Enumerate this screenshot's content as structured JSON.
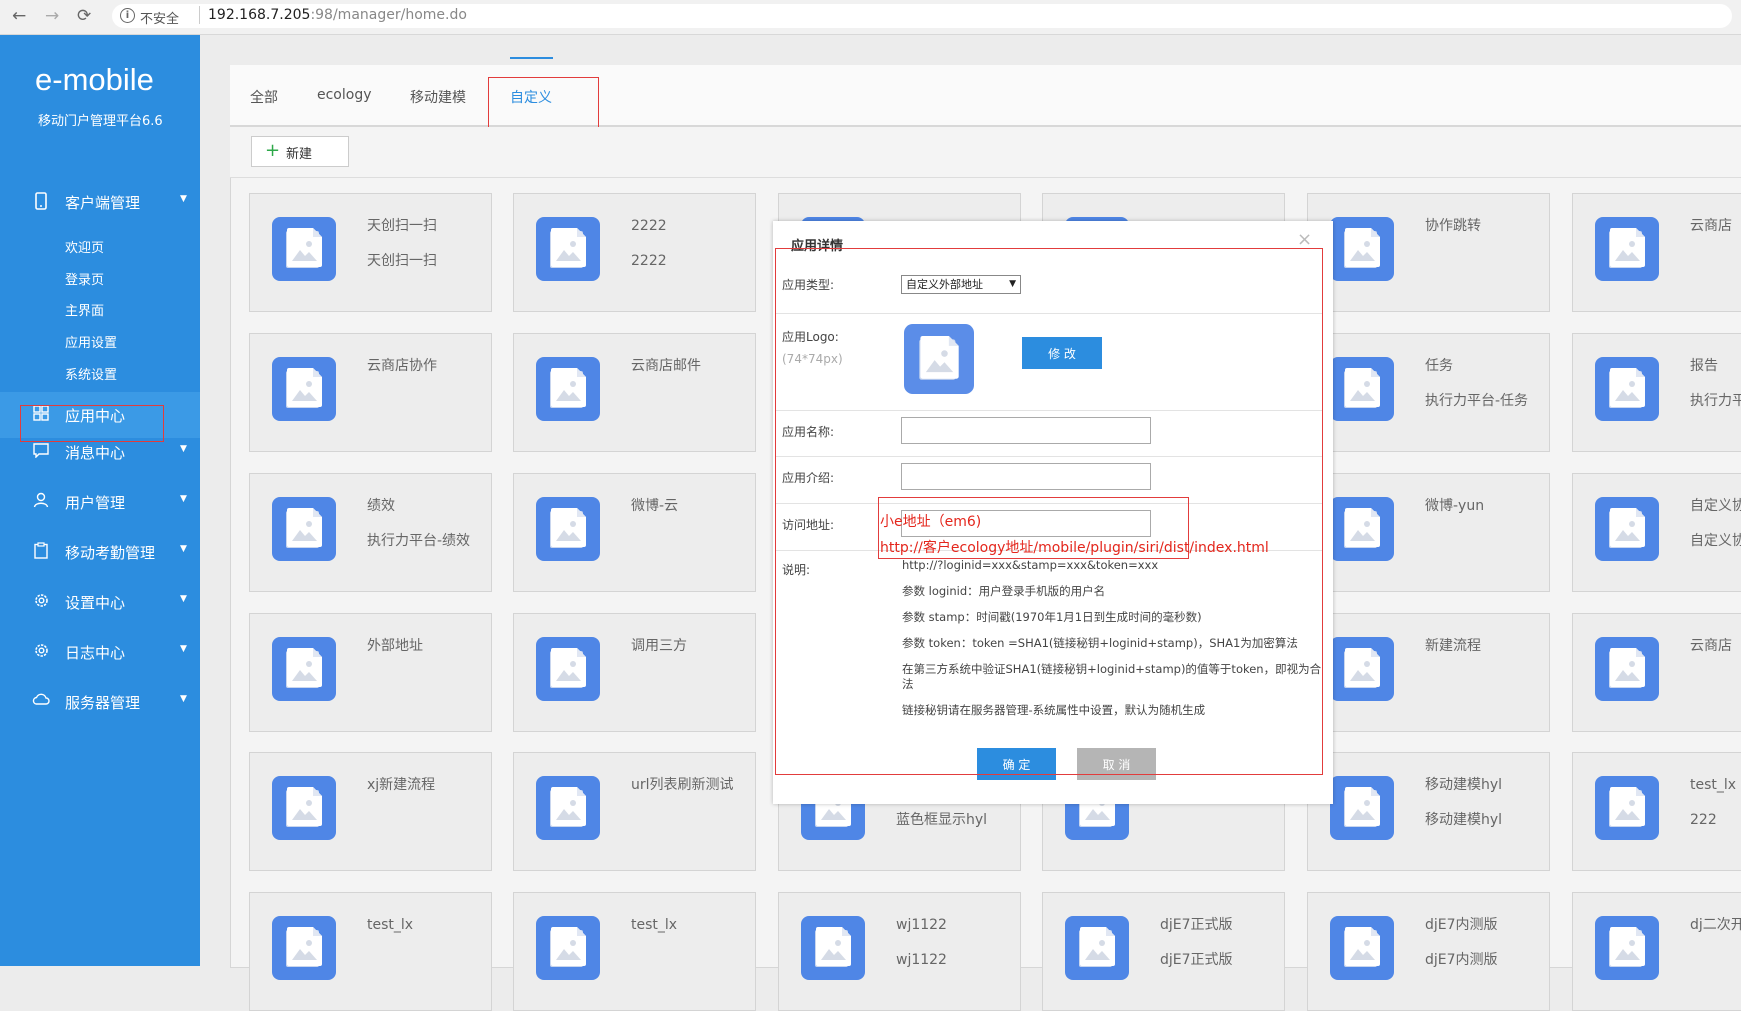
{
  "browser": {
    "back": "←",
    "forward": "→",
    "reload": "⟳",
    "security_label": "不安全",
    "url_host": "192.168.7.205",
    "url_rest": ":98/manager/home.do"
  },
  "sidebar": {
    "brand": "e-mobile",
    "brand_sub": "移动门户管理平台6.6",
    "menu_client": "客户端管理",
    "sub_items": [
      "欢迎页",
      "登录页",
      "主界面",
      "应用设置",
      "系统设置"
    ],
    "menu_apps": "应用中心",
    "menu_msg": "消息中心",
    "menu_users": "用户管理",
    "menu_attendance": "移动考勤管理",
    "menu_settings": "设置中心",
    "menu_logs": "日志中心",
    "menu_server": "服务器管理"
  },
  "tabs": [
    "全部",
    "ecology",
    "移动建模",
    "自定义"
  ],
  "toolbar": {
    "new_label": "新建"
  },
  "cards": [
    {
      "t1": "天创扫一扫",
      "t2": "天创扫一扫"
    },
    {
      "t1": "2222",
      "t2": "2222"
    },
    {
      "t1": "",
      "t2": ""
    },
    {
      "t1": "",
      "t2": ""
    },
    {
      "t1": "协作跳转",
      "t2": ""
    },
    {
      "t1": "云商店",
      "t2": ""
    },
    {
      "t1": "云商店协作",
      "t2": ""
    },
    {
      "t1": "云商店邮件",
      "t2": ""
    },
    {
      "t1": "",
      "t2": ""
    },
    {
      "t1": "",
      "t2": ""
    },
    {
      "t1": "任务",
      "t2": "执行力平台-任务"
    },
    {
      "t1": "报告",
      "t2": "执行力平台-报告"
    },
    {
      "t1": "绩效",
      "t2": "执行力平台-绩效"
    },
    {
      "t1": "微博-云",
      "t2": ""
    },
    {
      "t1": "",
      "t2": ""
    },
    {
      "t1": "",
      "t2": ""
    },
    {
      "t1": "微博-yun",
      "t2": ""
    },
    {
      "t1": "自定义协议",
      "t2": "自定义协议"
    },
    {
      "t1": "外部地址",
      "t2": ""
    },
    {
      "t1": "调用三方",
      "t2": ""
    },
    {
      "t1": "",
      "t2": ""
    },
    {
      "t1": "",
      "t2": ""
    },
    {
      "t1": "新建流程",
      "t2": ""
    },
    {
      "t1": "云商店",
      "t2": ""
    },
    {
      "t1": "xj新建流程",
      "t2": ""
    },
    {
      "t1": "url列表刷新测试",
      "t2": ""
    },
    {
      "t1": "",
      "t2": "蓝色框显示hyl"
    },
    {
      "t1": "",
      "t2": ""
    },
    {
      "t1": "移动建模hyl",
      "t2": "移动建模hyl"
    },
    {
      "t1": "test_lx",
      "t2": "222"
    },
    {
      "t1": "test_lx",
      "t2": ""
    },
    {
      "t1": "test_lx",
      "t2": ""
    },
    {
      "t1": "wj1122",
      "t2": "wj1122"
    },
    {
      "t1": "djE7正式版",
      "t2": "djE7正式版"
    },
    {
      "t1": "djE7内测版",
      "t2": "djE7内测版"
    },
    {
      "t1": "dj二次开发本",
      "t2": ""
    }
  ],
  "modal": {
    "title": "应用详情",
    "close": "×",
    "type_label": "应用类型:",
    "type_value": "自定义外部地址",
    "logo_label": "应用Logo:",
    "logo_hint": "(74*74px)",
    "edit_label": "修 改",
    "name_label": "应用名称:",
    "intro_label": "应用介绍:",
    "url_label": "访问地址:",
    "desc_label": "说明:",
    "desc_lines": [
      "http://?loginid=xxx&stamp=xxx&token=xxx",
      "参数 loginid：用户登录手机版的用户名",
      "参数 stamp：时间戳(1970年1月1日到生成时间的毫秒数)",
      "参数 token：token =SHA1(链接秘钥+loginid+stamp)，SHA1为加密算法",
      "在第三方系统中验证SHA1(链接秘钥+loginid+stamp)的值等于token，即视为合法",
      "链接秘钥请在服务器管理-系统属性中设置，默认为随机生成"
    ],
    "annotation_1": "小e地址（em6)",
    "annotation_2": "http://客户ecology地址/mobile/plugin/siri/dist/index.html",
    "ok_label": "确 定",
    "cancel_label": "取 消"
  },
  "colors": {
    "sidebar": "#2c8ddf",
    "accent": "#2c8ddf",
    "annotation_red": "#e23c3c"
  }
}
